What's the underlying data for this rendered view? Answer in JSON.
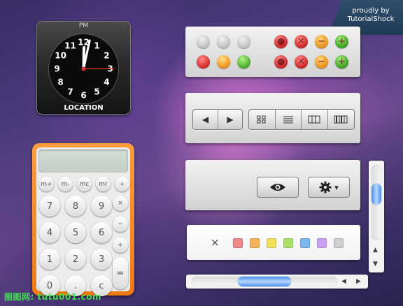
{
  "ribbon": {
    "line1": "proudly by",
    "line2": "TutorialShock"
  },
  "clock": {
    "period": "PM",
    "location": "LOCATION",
    "numerals": [
      "12",
      "1",
      "2",
      "3",
      "4",
      "5",
      "6",
      "7",
      "8",
      "9",
      "10",
      "11"
    ],
    "time": {
      "hour": 12,
      "minute": 2,
      "second": 15
    }
  },
  "calculator": {
    "memory_keys": [
      "m+",
      "m-",
      "mc",
      "mr",
      "÷"
    ],
    "digit_rows": [
      [
        "7",
        "8",
        "9"
      ],
      [
        "4",
        "5",
        "6"
      ],
      [
        "1",
        "2",
        "3"
      ],
      [
        "0",
        ".",
        "c"
      ]
    ],
    "op_keys": [
      "×",
      "−",
      "+"
    ],
    "equals": "="
  },
  "status_lights": {
    "top_row": [
      "gray",
      "gray",
      "gray",
      "red-record",
      "red-close",
      "orange-minimize",
      "green-plus"
    ],
    "bottom_row": [
      "red",
      "orange",
      "green",
      "red-record",
      "red-close",
      "orange-minimize",
      "green-plus"
    ]
  },
  "toolbar": {
    "back_icon": "◀",
    "forward_icon": "▶",
    "view_modes": [
      "icon-view",
      "list-view",
      "column-view",
      "coverflow-view"
    ]
  },
  "actions": {
    "eye_icon": "eye-icon",
    "gear_icon": "gear-icon",
    "dropdown_caret": "▾"
  },
  "labels": {
    "clear_symbol": "×",
    "colors": [
      "#f08a8a",
      "#f5b25a",
      "#f0e05a",
      "#a8e06a",
      "#7ab6f0",
      "#c9a0f0",
      "#cfcfcf"
    ]
  },
  "vertical_scroll": {
    "position": 0.34,
    "up": "▲",
    "down": "▼"
  },
  "horizontal_scroll": {
    "position": 0.5,
    "left": "◀",
    "right": "▶"
  },
  "watermark": "图图网: tutu001.com"
}
